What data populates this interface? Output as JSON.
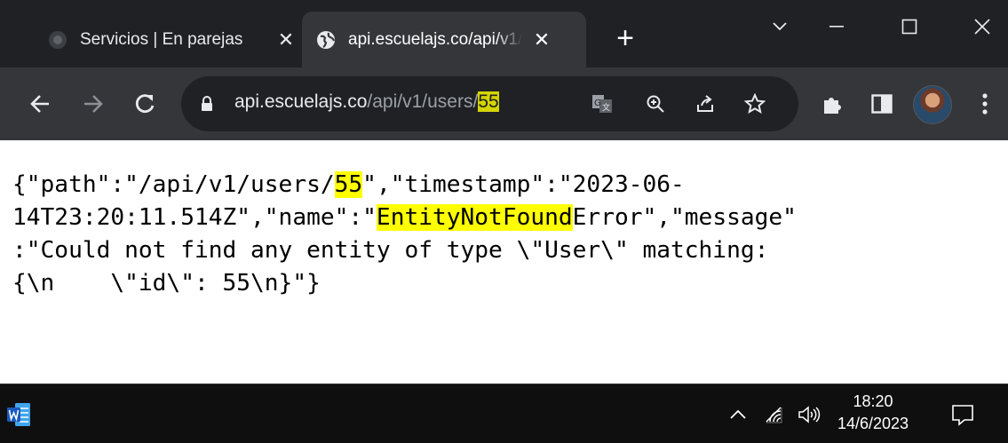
{
  "browser": {
    "tabs": [
      {
        "title": "Servicios | En parejas",
        "close": "✕",
        "active": false,
        "favicon": "generic-site-icon"
      },
      {
        "title": "api.escuelajs.co/api/v1/users/55",
        "close": "✕",
        "active": true,
        "favicon": "globe-icon"
      }
    ],
    "new_tab": "+",
    "address": {
      "host": "api.escuelajs.co",
      "path": "/api/v1/users/",
      "highlight": "55"
    },
    "accent_color": "#d4d400"
  },
  "page": {
    "lines": [
      {
        "segments": [
          {
            "text": "{\"path\":\"/api/v1/users/",
            "hl": false
          },
          {
            "text": "55",
            "hl": true
          },
          {
            "text": "\",\"timestamp\":\"2023-06-",
            "hl": false
          }
        ]
      },
      {
        "segments": [
          {
            "text": "14T23:20:11.514Z\",\"name\":\"",
            "hl": false
          },
          {
            "text": "EntityNotFound",
            "hl": true
          },
          {
            "text": "Error\",\"message\"",
            "hl": false
          }
        ]
      },
      {
        "segments": [
          {
            "text": ":\"Could not find any entity of type \\\"User\\\" matching:",
            "hl": false
          }
        ]
      },
      {
        "segments": [
          {
            "text": "{\\n    \\\"id\\\": 55\\n}\"}",
            "hl": false
          }
        ]
      }
    ],
    "highlight_color": "#ffff00"
  },
  "taskbar": {
    "time": "18:20",
    "date": "14/6/2023",
    "pinned": [
      "word-icon"
    ]
  }
}
